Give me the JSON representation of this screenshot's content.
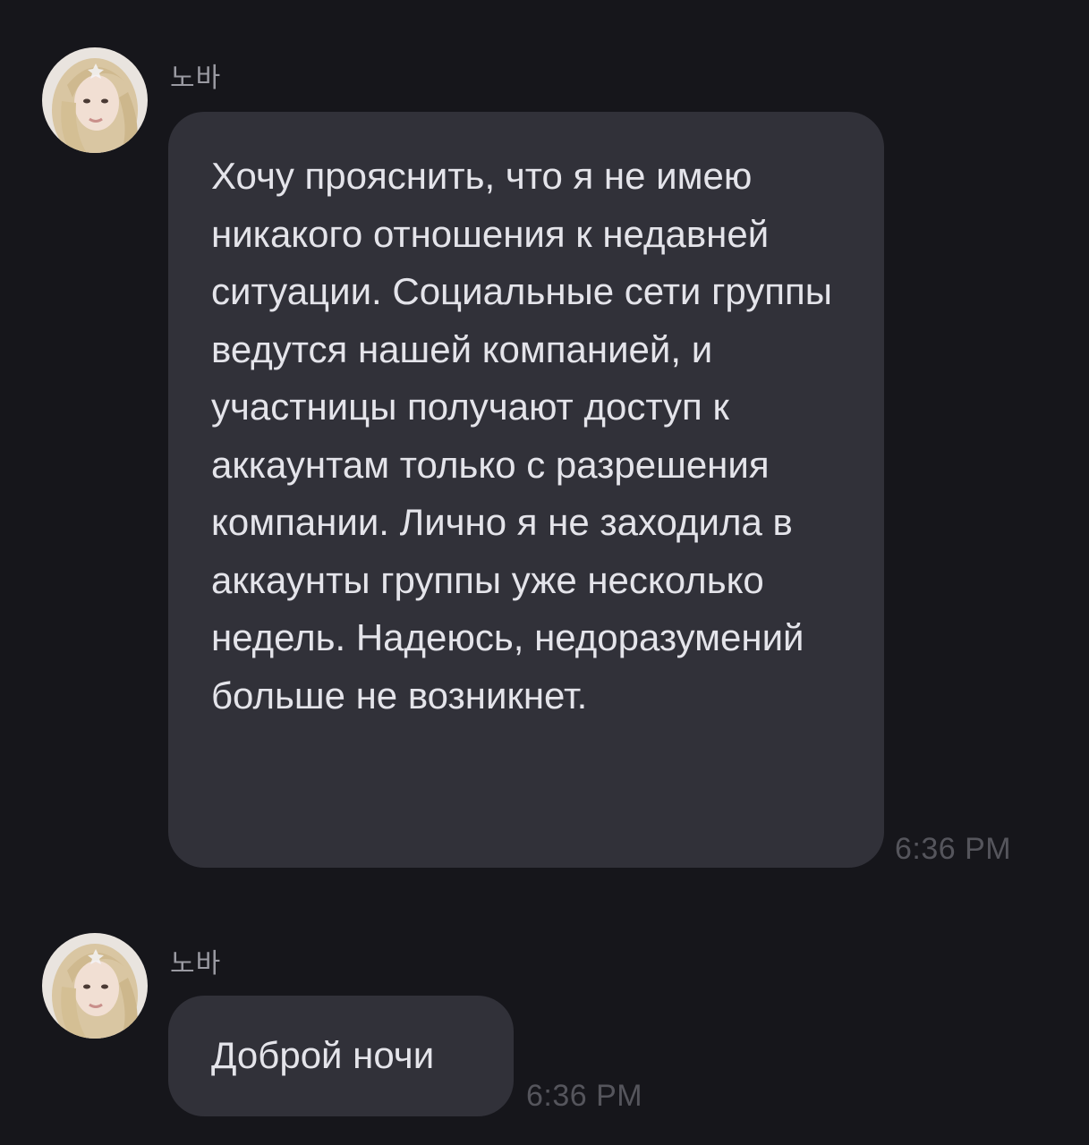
{
  "messages": [
    {
      "sender": "노바",
      "text": "Хочу прояснить, что я не имею никакого отношения к недавней ситуации. Социальные сети группы ведутся нашей компанией, и участницы получают доступ к аккаунтам только с разрешения компании. Лично я не заходила в аккаунты группы уже несколько недель. Надеюсь, недоразумений больше не возникнет.",
      "time": "6:36 PM"
    },
    {
      "sender": "노바",
      "text": "Доброй ночи",
      "time": "6:36 PM"
    }
  ],
  "colors": {
    "background": "#16161b",
    "bubble": "#313139",
    "text": "#e4e4ea",
    "name": "#9a9aa2",
    "timestamp": "#55555c"
  },
  "icons": {
    "avatar": "profile-photo"
  }
}
